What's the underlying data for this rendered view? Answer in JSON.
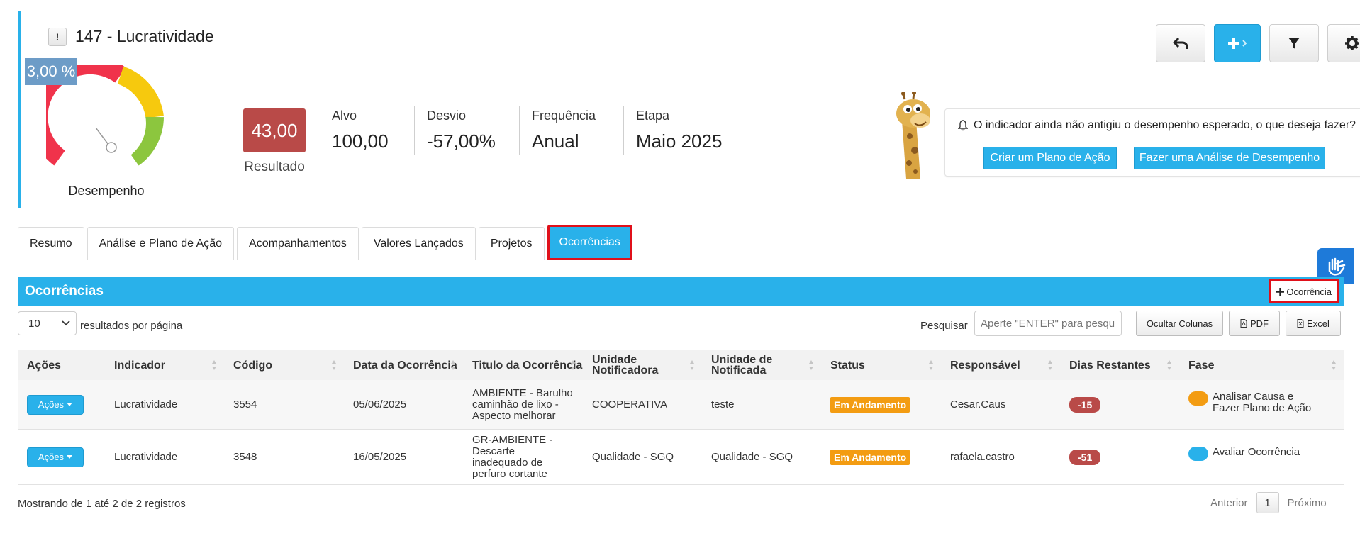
{
  "header": {
    "alert_symbol": "!",
    "title": "147 - Lucratividade",
    "performance_badge": "3,00 %",
    "gauge_label": "Desempenho",
    "gauge_level_fraction": 0.33,
    "result_value": "43,00",
    "result_label": "Resultado",
    "stats": [
      {
        "label": "Alvo",
        "value": "100,00"
      },
      {
        "label": "Desvio",
        "value": "-57,00%"
      },
      {
        "label": "Frequência",
        "value": "Anual"
      },
      {
        "label": "Etapa",
        "value": "Maio 2025"
      }
    ]
  },
  "notice": {
    "text": "O indicador ainda não antigiu o desempenho esperado, o que deseja fazer?",
    "action_plan_label": "Criar um Plano de Ação",
    "analysis_label": "Fazer uma Análise de Desempenho"
  },
  "tabs": [
    {
      "label": "Resumo",
      "active": false
    },
    {
      "label": "Análise e Plano de Ação",
      "active": false
    },
    {
      "label": "Acompanhamentos",
      "active": false
    },
    {
      "label": "Valores Lançados",
      "active": false
    },
    {
      "label": "Projetos",
      "active": false
    },
    {
      "label": "Ocorrências",
      "active": true
    }
  ],
  "section": {
    "title": "Ocorrências",
    "add_label": "Ocorrência"
  },
  "controls": {
    "page_size": "10",
    "page_size_suffix": "resultados por página",
    "search_label": "Pesquisar",
    "search_placeholder": "Aperte \"ENTER\" para pesquisar",
    "hide_columns_label": "Ocultar Colunas",
    "pdf_label": "PDF",
    "excel_label": "Excel"
  },
  "table": {
    "headers": [
      "Ações",
      "Indicador",
      "Código",
      "Data da Ocorrência",
      "Titulo da Ocorrência",
      "Unidade Notificadora",
      "Unidade de Notificada",
      "Status",
      "Responsável",
      "Dias Restantes",
      "Fase"
    ],
    "actions_label": "Ações",
    "rows": [
      {
        "indicador": "Lucratividade",
        "codigo": "3554",
        "data": "05/06/2025",
        "titulo": "AMBIENTE - Barulho caminhão de lixo - Aspecto melhorar",
        "notificadora": "COOPERATIVA",
        "notificada": "teste",
        "status": "Em Andamento",
        "responsavel": "Cesar.Caus",
        "dias": "-15",
        "fase": "Analisar Causa e Fazer Plano de Ação",
        "fase_color": "#f39c12"
      },
      {
        "indicador": "Lucratividade",
        "codigo": "3548",
        "data": "16/05/2025",
        "titulo": "GR-AMBIENTE - Descarte inadequado de perfuro cortante",
        "notificadora": "Qualidade - SGQ",
        "notificada": "Qualidade - SGQ",
        "status": "Em Andamento",
        "responsavel": "rafaela.castro",
        "dias": "-51",
        "fase": "Avaliar Ocorrência",
        "fase_color": "#29b1ea"
      }
    ]
  },
  "footer": {
    "info": "Mostrando de 1 até 2 de 2 registros",
    "prev_label": "Anterior",
    "current_page": "1",
    "next_label": "Próximo"
  },
  "colors": {
    "accent": "#29b1ea",
    "danger": "#b94a48",
    "warning": "#f39c12",
    "highlight_border": "#e0101a"
  },
  "icons": [
    "alert-icon",
    "undo-icon",
    "plus-arrow-icon",
    "filter-icon",
    "gear-icon",
    "bell-icon",
    "giraffe-mascot-icon",
    "sign-language-icon",
    "plus-icon",
    "pdf-file-icon",
    "excel-file-icon",
    "caret-down-icon",
    "sort-icon"
  ]
}
